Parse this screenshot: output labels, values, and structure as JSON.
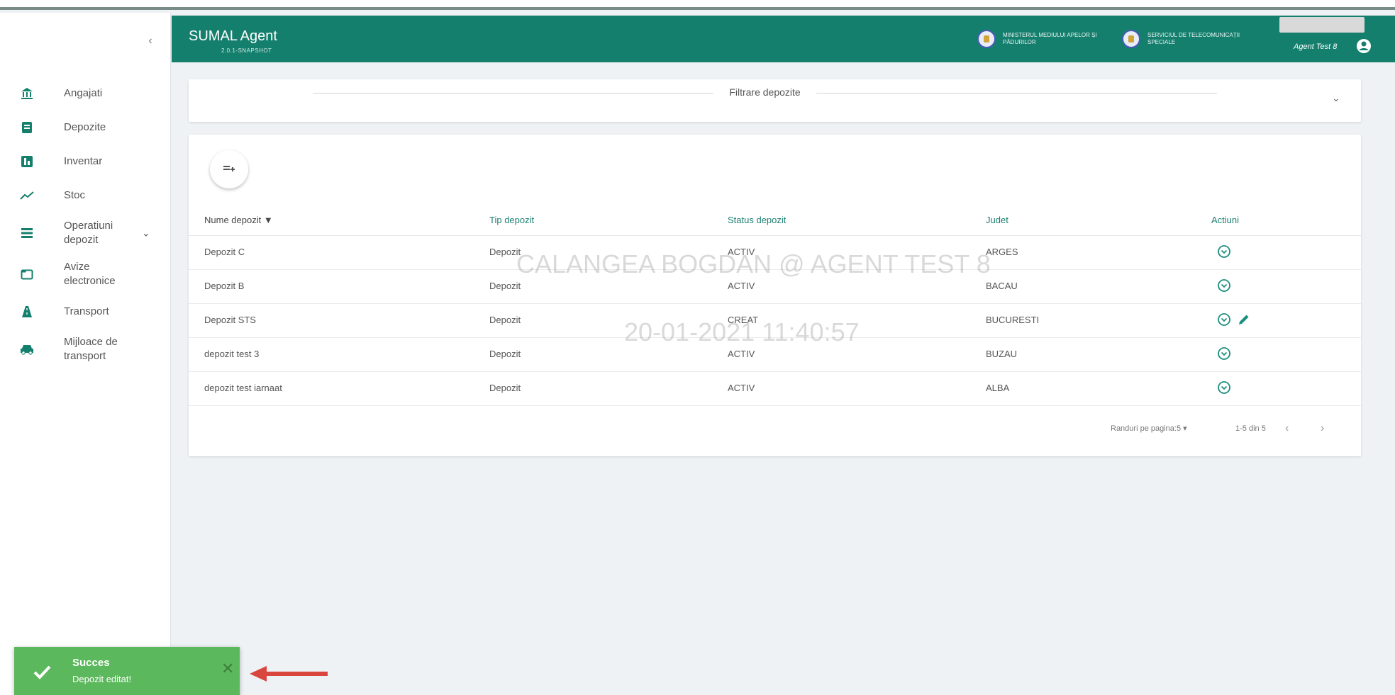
{
  "app": {
    "title": "SUMAL Agent",
    "subtitle": "2.0.1-SNAPSHOT"
  },
  "header": {
    "ministry_text": "MINISTERUL MEDIULUI APELOR ȘI PĂDURILOR",
    "service_text": "SERVICIUL DE TELECOMUNICAȚII SPECIALE",
    "user_name": "Agent Test 8"
  },
  "sidebar": {
    "collapse_glyph": "‹",
    "items": [
      {
        "label": "Angajati",
        "icon": "bank-icon"
      },
      {
        "label": "Depozite",
        "icon": "depot-icon"
      },
      {
        "label": "Inventar",
        "icon": "inventory-icon"
      },
      {
        "label": "Stoc",
        "icon": "trend-icon"
      },
      {
        "label": "Operatiuni depozit",
        "icon": "list-icon",
        "chevron": "⌄"
      },
      {
        "label": "Avize electronice",
        "icon": "folder-icon"
      },
      {
        "label": "Transport",
        "icon": "road-icon"
      },
      {
        "label": "Mijloace de transport",
        "icon": "car-icon"
      }
    ]
  },
  "filter": {
    "title": "Filtrare depozite",
    "chevron": "⌄"
  },
  "table": {
    "columns": [
      "Nume depozit ▼",
      "Tip depozit",
      "Status depozit",
      "Judet",
      "Actiuni"
    ],
    "rows": [
      {
        "nume": "Depozit C",
        "tip": "Depozit",
        "status": "ACTIV",
        "judet": "ARGES",
        "edit": false
      },
      {
        "nume": "Depozit B",
        "tip": "Depozit",
        "status": "ACTIV",
        "judet": "BACAU",
        "edit": false
      },
      {
        "nume": "Depozit STS",
        "tip": "Depozit",
        "status": "CREAT",
        "judet": "BUCURESTI",
        "edit": true
      },
      {
        "nume": "depozit test 3",
        "tip": "Depozit",
        "status": "ACTIV",
        "judet": "BUZAU",
        "edit": false
      },
      {
        "nume": "depozit test iarnaat",
        "tip": "Depozit",
        "status": "ACTIV",
        "judet": "ALBA",
        "edit": false
      }
    ],
    "pager": {
      "label": "Randuri pe pagina:",
      "per_page": "5 ▾",
      "range": "1-5 din 5",
      "prev": "‹",
      "next": "›"
    }
  },
  "watermark": {
    "line1": "CALANGEA BOGDAN @ AGENT TEST 8",
    "line2": "20-01-2021 11:40:57"
  },
  "toast": {
    "title": "Succes",
    "message": "Depozit editat!",
    "close": "✕"
  },
  "colors": {
    "primary": "#157f6e",
    "toast": "#5cb85c",
    "arrow": "#d9463e"
  }
}
